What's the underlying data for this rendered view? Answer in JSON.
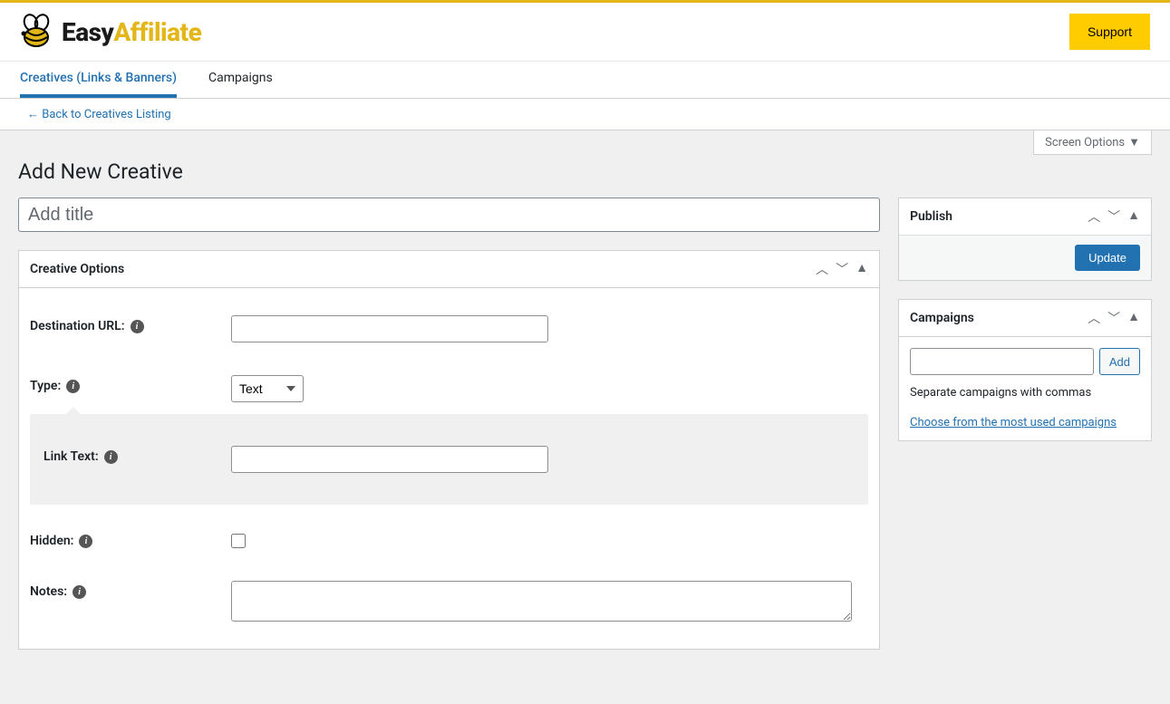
{
  "brand": {
    "easy": "Easy",
    "affiliate": "Affiliate"
  },
  "header": {
    "support": "Support"
  },
  "tabs": {
    "creatives": "Creatives (Links & Banners)",
    "campaigns": "Campaigns"
  },
  "back_link": "← Back to Creatives Listing",
  "screen_options": "Screen Options",
  "page_title": "Add New Creative",
  "title_placeholder": "Add title",
  "creative_options": {
    "heading": "Creative Options",
    "dest_url_label": "Destination URL:",
    "dest_url_value": "",
    "type_label": "Type:",
    "type_value": "Text",
    "link_text_label": "Link Text:",
    "link_text_value": "",
    "hidden_label": "Hidden:",
    "notes_label": "Notes:",
    "notes_value": ""
  },
  "publish": {
    "heading": "Publish",
    "update": "Update"
  },
  "campaigns_box": {
    "heading": "Campaigns",
    "add": "Add",
    "help": "Separate campaigns with commas",
    "choose": "Choose from the most used campaigns"
  }
}
